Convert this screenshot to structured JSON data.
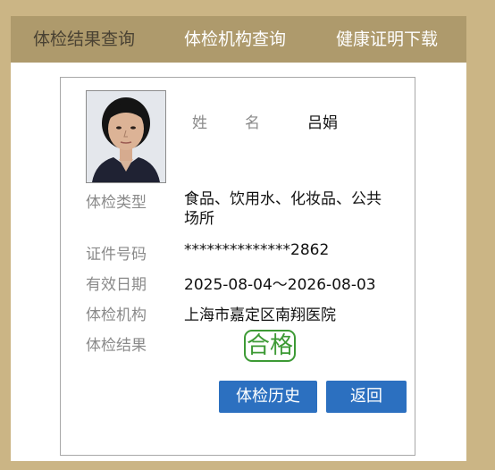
{
  "nav": {
    "tabs": [
      {
        "label": "体检结果查询"
      },
      {
        "label": "体检机构查询"
      },
      {
        "label": "健康证明下载"
      }
    ]
  },
  "card": {
    "name": {
      "label_chars": [
        "姓",
        "名"
      ],
      "value": "吕娟"
    },
    "fields": [
      {
        "label": "体检类型",
        "value": "食品、饮用水、化妆品、公共场所"
      },
      {
        "label": "证件号码",
        "value": "**************2862"
      },
      {
        "label": "有效日期",
        "value": "2025-08-04～2026-08-03"
      },
      {
        "label": "体检机构",
        "value": "上海市嘉定区南翔医院"
      },
      {
        "label": "体检结果",
        "value": "合格"
      }
    ],
    "buttons": {
      "history": "体检历史",
      "back": "返回"
    }
  },
  "colors": {
    "background": "#cbb585",
    "navbar": "#ae9a6c",
    "button": "#2c70c0",
    "stamp": "#3d9a35"
  }
}
